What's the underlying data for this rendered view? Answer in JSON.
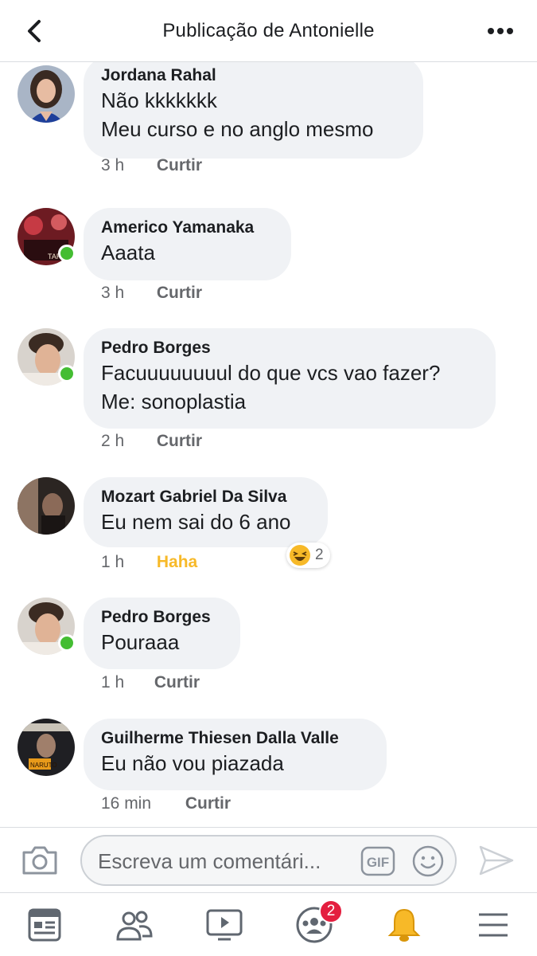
{
  "header": {
    "title": "Publicação de Antonielle"
  },
  "comments": [
    {
      "author": "Jordana Rahal",
      "lines": [
        "Não kkkkkkk",
        "Meu curso e no anglo mesmo"
      ],
      "time": "3 h",
      "action": "Curtir",
      "online": false
    },
    {
      "author": "Americo Yamanaka",
      "lines": [
        "Aaata"
      ],
      "time": "3 h",
      "action": "Curtir",
      "online": true
    },
    {
      "author": "Pedro Borges",
      "lines": [
        "Facuuuuuuuul do que vcs vao fazer?",
        "Me: sonoplastia"
      ],
      "time": "2 h",
      "action": "Curtir",
      "online": true
    },
    {
      "author": "Mozart Gabriel Da Silva",
      "lines": [
        "Eu nem sai do 6 ano"
      ],
      "time": "1 h",
      "action": "Haha",
      "online": false,
      "reaction": {
        "icon": "haha-emoji-icon",
        "count": "2"
      }
    },
    {
      "author": "Pedro Borges",
      "lines": [
        "Pouraaa"
      ],
      "time": "1 h",
      "action": "Curtir",
      "online": true
    },
    {
      "author": "Guilherme Thiesen Dalla Valle",
      "lines": [
        "Eu não vou piazada"
      ],
      "time": "16 min",
      "action": "Curtir",
      "online": false
    }
  ],
  "composer": {
    "placeholder": "Escreva um comentári...",
    "gif_label": "GIF"
  },
  "tabbar": {
    "items": [
      "news-feed-icon",
      "friends-icon",
      "watch-icon",
      "groups-icon",
      "notifications-bell-icon",
      "menu-icon"
    ],
    "groups_badge": "2"
  },
  "colors": {
    "online": "#44bd32",
    "haha": "#f7b928",
    "badge": "#e41e3f",
    "bubble": "#f0f2f5"
  }
}
